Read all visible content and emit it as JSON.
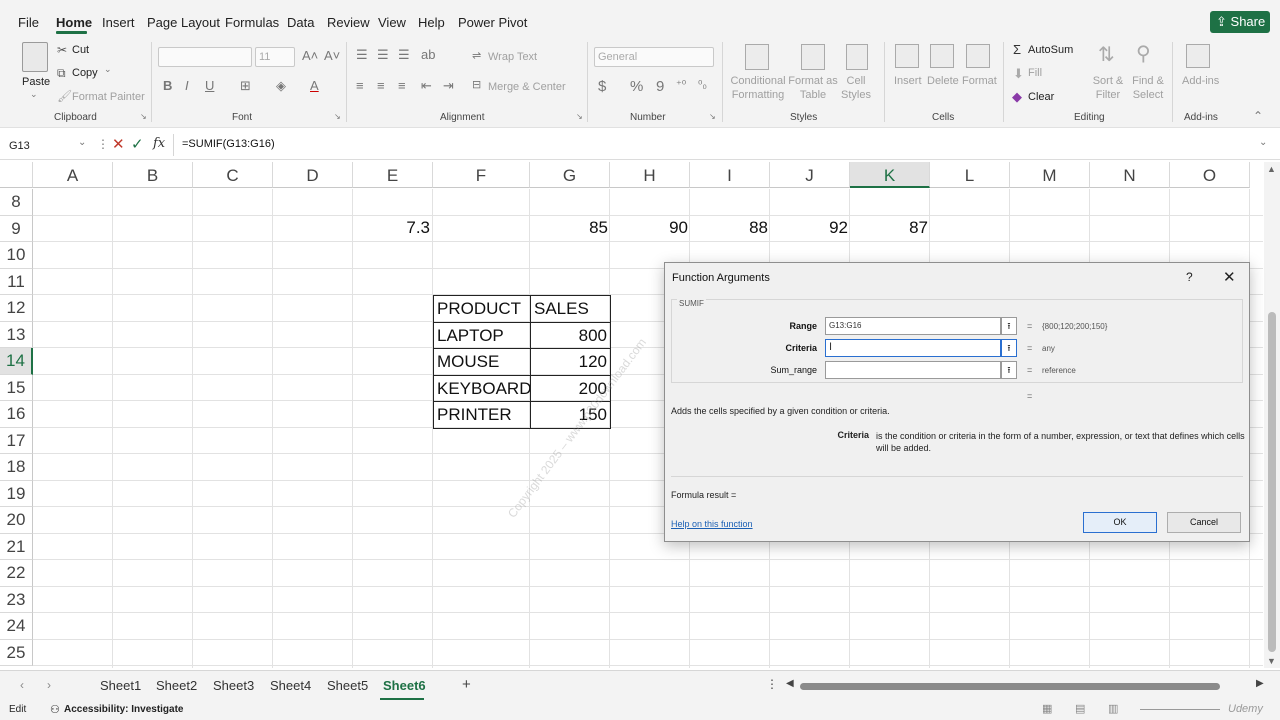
{
  "menu": {
    "items": [
      "File",
      "Home",
      "Insert",
      "Page Layout",
      "Formulas",
      "Data",
      "Review",
      "View",
      "Help",
      "Power Pivot"
    ],
    "share_label": "Share"
  },
  "ribbon": {
    "clipboard": {
      "paste": "Paste",
      "cut": "Cut",
      "copy": "Copy",
      "format_painter": "Format Painter",
      "label": "Clipboard"
    },
    "font": {
      "size_value": "11",
      "bold": "B",
      "italic": "I",
      "underline": "U",
      "label": "Font"
    },
    "alignment": {
      "wrap_text": "Wrap Text",
      "merge_center": "Merge & Center",
      "label": "Alignment"
    },
    "number": {
      "format_value": "General",
      "currency": "$",
      "percent": "%",
      "comma": "9",
      "label": "Number"
    },
    "styles": {
      "conditional_formatting": "Conditional Formatting",
      "format_as_table": "Format as Table",
      "cell_styles": "Cell Styles",
      "label": "Styles"
    },
    "cells": {
      "insert": "Insert",
      "delete": "Delete",
      "format": "Format",
      "label": "Cells"
    },
    "editing": {
      "autosum": "AutoSum",
      "fill": "Fill",
      "clear": "Clear",
      "sort_filter": "Sort & Filter",
      "find_select": "Find & Select",
      "label": "Editing"
    },
    "addins": {
      "addins": "Add-ins",
      "label": "Add-ins"
    }
  },
  "formula_bar": {
    "name_box": "G13",
    "fx": "fx",
    "formula": "=SUMIF(G13:G16)"
  },
  "grid": {
    "columns": [
      "A",
      "B",
      "C",
      "D",
      "E",
      "F",
      "G",
      "H",
      "I",
      "J",
      "K",
      "L",
      "M",
      "N",
      "O"
    ],
    "selected_column": "K",
    "rows": [
      "8",
      "9",
      "10",
      "11",
      "12",
      "13",
      "14",
      "15",
      "16",
      "17",
      "18",
      "19",
      "20",
      "21",
      "22",
      "23",
      "24",
      "25"
    ],
    "selected_row": "14",
    "row9": {
      "E": "7.3",
      "G": "85",
      "H": "90",
      "I": "88",
      "J": "92",
      "K": "87"
    },
    "table": {
      "headers": [
        "PRODUCT",
        "SALES"
      ],
      "rows": [
        [
          "LAPTOP",
          "800"
        ],
        [
          "MOUSE",
          "120"
        ],
        [
          "KEYBOARD",
          "200"
        ],
        [
          "PRINTER",
          "150"
        ]
      ]
    }
  },
  "dialog": {
    "title": "Function Arguments",
    "help_glyph": "?",
    "close_glyph": "✕",
    "function_name": "SUMIF",
    "args": [
      {
        "label": "Range",
        "value": "G13:G16",
        "result": "{800;120;200;150}"
      },
      {
        "label": "Criteria",
        "value": "",
        "result": "any"
      },
      {
        "label": "Sum_range",
        "value": "",
        "result": "reference"
      }
    ],
    "equals": "=",
    "description": "Adds the cells specified by a given condition or criteria.",
    "arg_desc_name": "Criteria",
    "arg_desc_text": "is the condition or criteria in the form of a number, expression, or text that defines which cells will be added.",
    "formula_result": "Formula result =",
    "help_link": "Help on this function",
    "ok": "OK",
    "cancel": "Cancel"
  },
  "sheets": {
    "tabs": [
      "Sheet1",
      "Sheet2",
      "Sheet3",
      "Sheet4",
      "Sheet5",
      "Sheet6"
    ],
    "active": "Sheet6",
    "add": "+"
  },
  "status": {
    "mode": "Edit",
    "accessibility": "Accessibility: Investigate",
    "watermark_corner": "Udemy"
  },
  "watermark": "Copyright 2025 – www.p30download.com",
  "colors": {
    "accent": "#1e7145",
    "dialog_focus": "#2a6fd0"
  }
}
